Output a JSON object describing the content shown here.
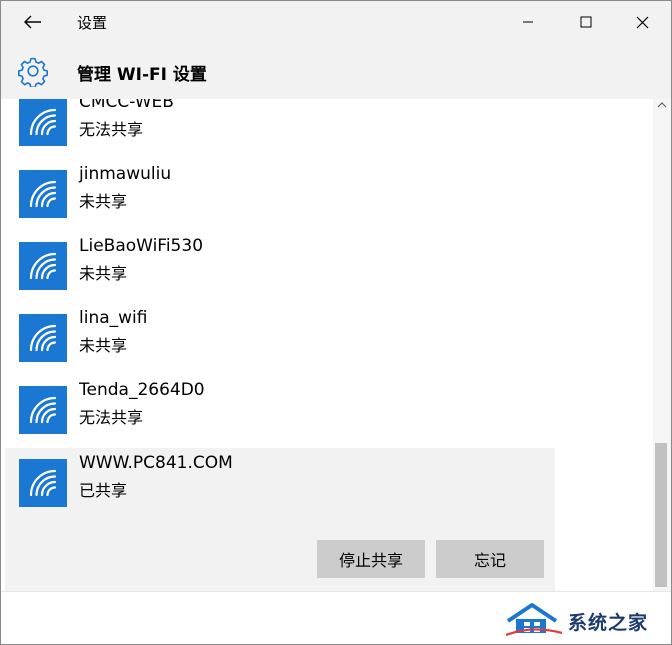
{
  "window": {
    "title": "设置",
    "controls": [
      "minimize",
      "maximize",
      "close"
    ]
  },
  "header": {
    "icon": "gear-icon",
    "title": "管理 WI-FI 设置"
  },
  "networks": [
    {
      "name": "CMCC-WEB",
      "status": "无法共享",
      "icon": "wifi-icon"
    },
    {
      "name": "jinmawuliu",
      "status": "未共享",
      "icon": "wifi-icon"
    },
    {
      "name": "LieBaoWiFi530",
      "status": "未共享",
      "icon": "wifi-icon"
    },
    {
      "name": "lina_wifi",
      "status": "未共享",
      "icon": "wifi-icon"
    },
    {
      "name": "Tenda_2664D0",
      "status": "无法共享",
      "icon": "wifi-icon"
    },
    {
      "name": "WWW.PC841.COM",
      "status": "已共享",
      "icon": "wifi-icon",
      "selected": true
    }
  ],
  "actions": {
    "stop_share_label": "停止共享",
    "forget_label": "忘记"
  },
  "watermark": {
    "text": "系统之家"
  },
  "colors": {
    "accent": "#1a78d2",
    "button_bg": "#cccccc",
    "header_bg": "#f2f2f2"
  }
}
